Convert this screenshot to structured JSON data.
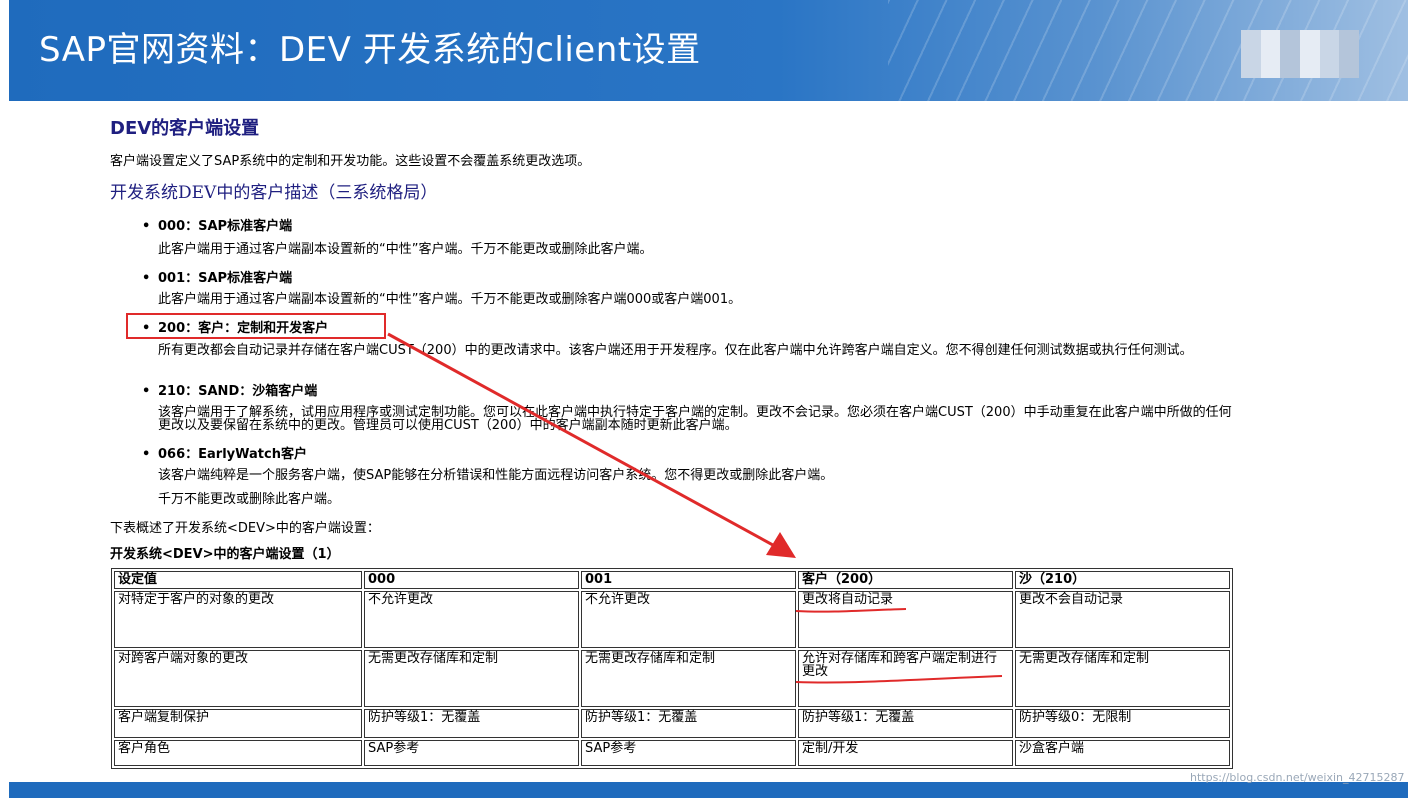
{
  "banner": {
    "title": "SAP官网资料：DEV 开发系统的client设置"
  },
  "doc": {
    "heading": "DEV的客户端设置",
    "intro": "客户端设置定义了SAP系统中的定制和开发功能。这些设置不会覆盖系统更改选项。",
    "subheading": "开发系统DEV中的客户描述（三系统格局）",
    "clients": [
      {
        "title": "000：SAP标准客户端",
        "desc": "此客户端用于通过客户端副本设置新的“中性”客户端。千万不能更改或删除此客户端。"
      },
      {
        "title": "001：SAP标准客户端",
        "desc": "此客户端用于通过客户端副本设置新的“中性”客户端。千万不能更改或删除客户端000或客户端001。"
      },
      {
        "title": "200：客户：定制和开发客户",
        "desc": "所有更改都会自动记录并存储在客户端CUST（200）中的更改请求中。该客户端还用于开发程序。仅在此客户端中允许跨客户端自定义。您不得创建任何测试数据或执行任何测试。"
      },
      {
        "title": "210：SAND：沙箱客户端",
        "desc": "该客户端用于了解系统，试用应用程序或测试定制功能。您可以在此客户端中执行特定于客户端的定制。更改不会记录。您必须在客户端CUST（200）中手动重复在此客户端中所做的任何更改以及要保留在系统中的更改。管理员可以使用CUST（200）中的客户端副本随时更新此客户端。"
      },
      {
        "title": "066：EarlyWatch客户",
        "desc": "该客户端纯粹是一个服务客户端，使SAP能够在分析错误和性能方面远程访问客户系统。您不得更改或删除此客户端。",
        "note": "千万不能更改或删除此客户端。"
      }
    ],
    "table_caption": "下表概述了开发系统<DEV>中的客户端设置：",
    "table_title": "开发系统<DEV>中的客户端设置（1）",
    "table": {
      "headers": [
        "设定值",
        "000",
        "001",
        "客户（200）",
        "沙（210）"
      ],
      "rows": [
        [
          "对特定于客户的对象的更改",
          "不允许更改",
          "不允许更改",
          "更改将自动记录",
          "更改不会自动记录"
        ],
        [
          "对跨客户端对象的更改",
          "无需更改存储库和定制",
          "无需更改存储库和定制",
          "允许对存储库和跨客户端定制进行更改",
          "无需更改存储库和定制"
        ],
        [
          "客户端复制保护",
          "防护等级1：无覆盖",
          "防护等级1：无覆盖",
          "防护等级1：无覆盖",
          "防护等级0：无限制"
        ],
        [
          "客户角色",
          "SAP参考",
          "SAP参考",
          "定制/开发",
          "沙盒客户端"
        ]
      ]
    }
  },
  "watermark": "https://blog.csdn.net/weixin_42715287",
  "colors": {
    "banner": "#1f6bbd",
    "annotation": "#e02a2a",
    "heading": "#1f1f80"
  }
}
